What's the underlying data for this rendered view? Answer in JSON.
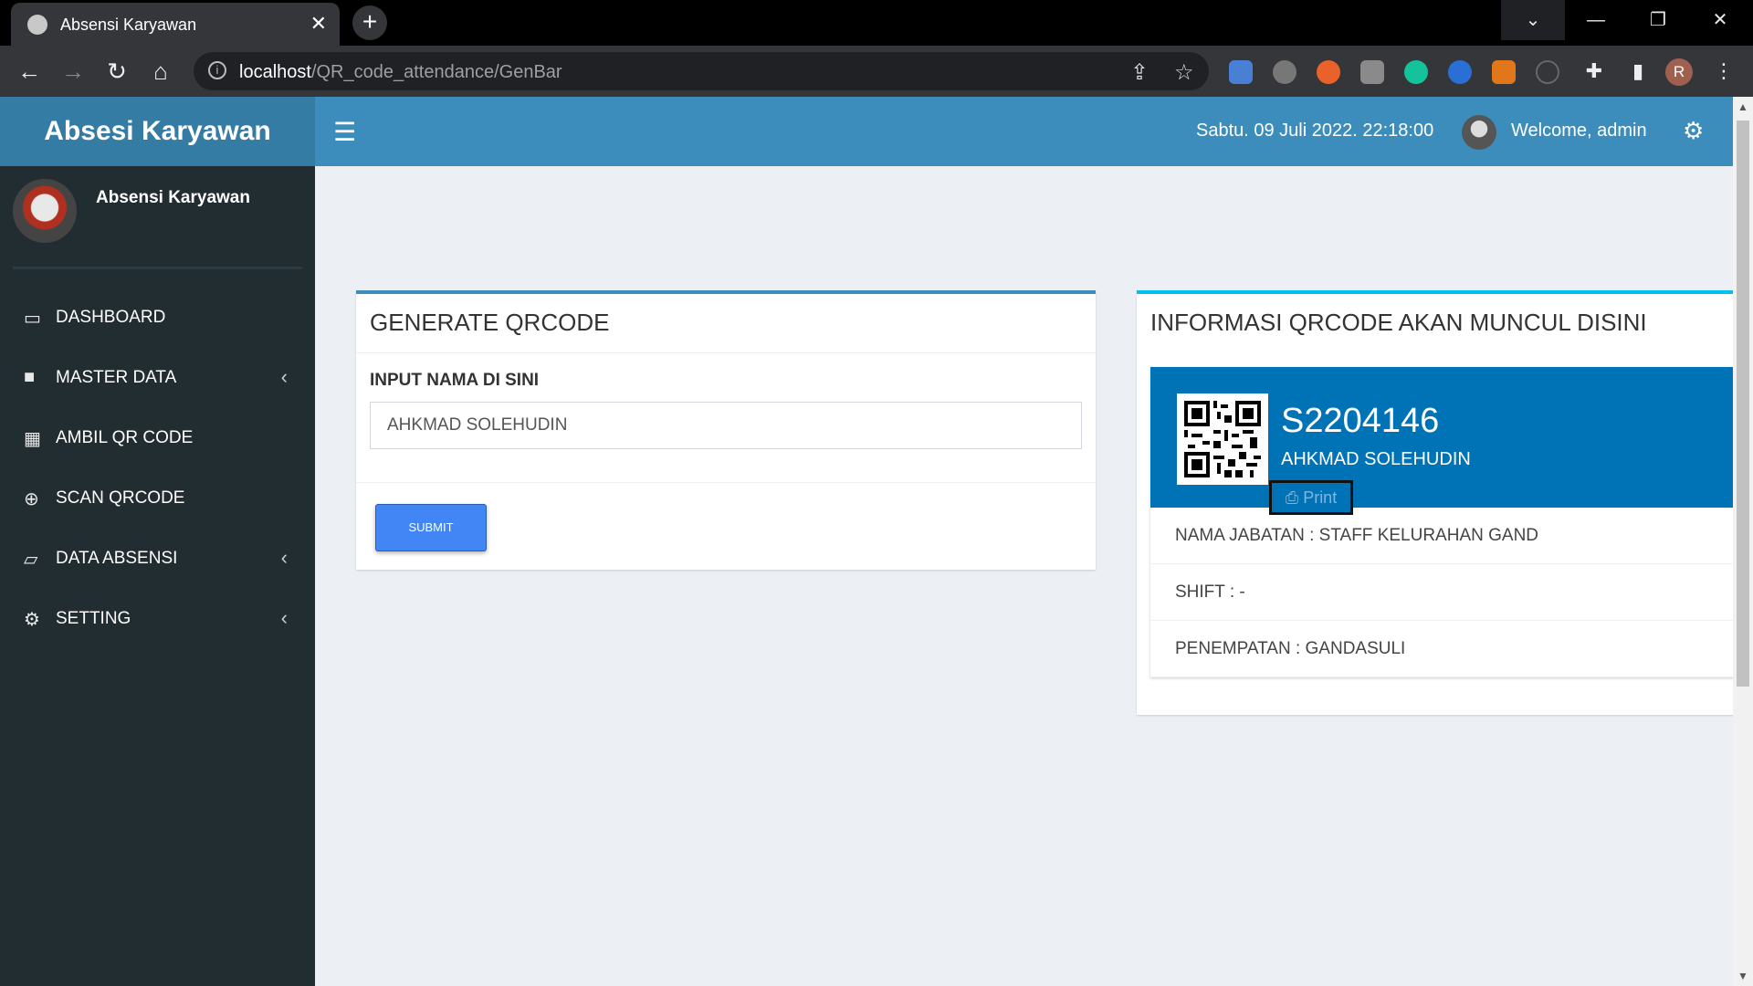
{
  "browser": {
    "tab_title": "Absensi Karyawan",
    "url_host": "localhost",
    "url_path": "/QR_code_attendance/GenBar",
    "profile_initial": "R"
  },
  "app": {
    "brand": "Absesi Karyawan",
    "datetime": "Sabtu. 09 Juli 2022. 22:18:00",
    "welcome": "Welcome, admin"
  },
  "sidebar": {
    "user_name": "Absensi Karyawan",
    "items": [
      {
        "label": "DASHBOARD",
        "icon": "laptop-icon",
        "has_submenu": false
      },
      {
        "label": "MASTER DATA",
        "icon": "folder-icon",
        "has_submenu": true
      },
      {
        "label": "AMBIL QR CODE",
        "icon": "qrcode-icon",
        "has_submenu": false
      },
      {
        "label": "SCAN QRCODE",
        "icon": "search-plus-icon",
        "has_submenu": false
      },
      {
        "label": "DATA ABSENSI",
        "icon": "folder-open-icon",
        "has_submenu": true
      },
      {
        "label": "SETTING",
        "icon": "gears-icon",
        "has_submenu": true
      }
    ]
  },
  "generate": {
    "title": "GENERATE QRCODE",
    "input_label": "INPUT NAMA DI SINI",
    "input_value": "AHKMAD SOLEHUDIN",
    "submit_label": "SUBMIT"
  },
  "info": {
    "title": "INFORMASI QRCODE AKAN MUNCUL DISINI",
    "code": "S2204146",
    "name": "AHKMAD SOLEHUDIN",
    "print_label": "Print",
    "rows": [
      "NAMA JABATAN : STAFF KELURAHAN GAND",
      "SHIFT : -",
      "PENEMPATAN : GANDASULI"
    ]
  },
  "colors": {
    "header_blue": "#3c8dbc",
    "brand_blue": "#357ca5",
    "sidebar_dark": "#222d32",
    "card_blue": "#0073b7",
    "submit_blue": "#4285f4"
  }
}
